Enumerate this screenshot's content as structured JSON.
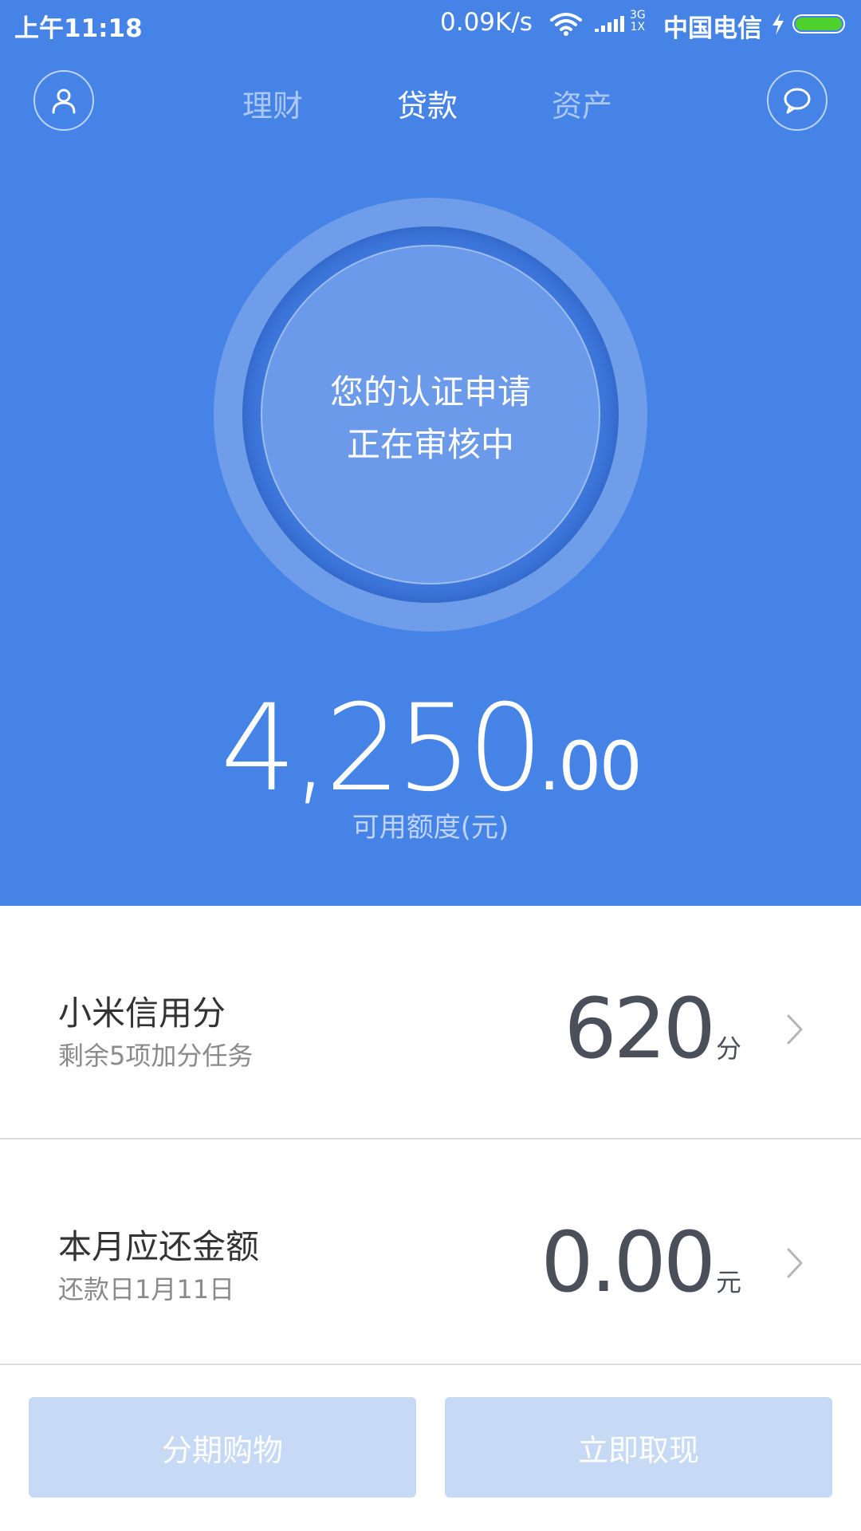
{
  "status_bar": {
    "time": "上午11:18",
    "speed": "0.09K/s",
    "network_top": "3G",
    "network_bottom": "1X",
    "carrier": "中国电信",
    "battery_level": 1.0,
    "icons": [
      "wifi-icon",
      "signal-icon",
      "charging-icon",
      "battery-icon"
    ]
  },
  "nav": {
    "left_icon": "user-icon",
    "right_icon": "message-icon",
    "tabs": [
      {
        "label": "理财",
        "active": false
      },
      {
        "label": "贷款",
        "active": true
      },
      {
        "label": "资产",
        "active": false
      }
    ]
  },
  "status_circle": {
    "line1": "您的认证申请",
    "line2": "正在审核中"
  },
  "credit": {
    "amount_int": "4,250",
    "amount_dec": ".00",
    "label": "可用额度(元)"
  },
  "rows": [
    {
      "title": "小米信用分",
      "subtitle": "剩余5项加分任务",
      "value": "620",
      "unit": "分"
    },
    {
      "title": "本月应还金额",
      "subtitle": "还款日1月11日",
      "value": "0.00",
      "unit": "元"
    }
  ],
  "buttons": {
    "installment": "分期购物",
    "withdraw": "立即取现"
  },
  "colors": {
    "primary_blue": "#4683e6",
    "button_disabled": "#c6d9f5",
    "battery_green": "#4fd12d"
  }
}
